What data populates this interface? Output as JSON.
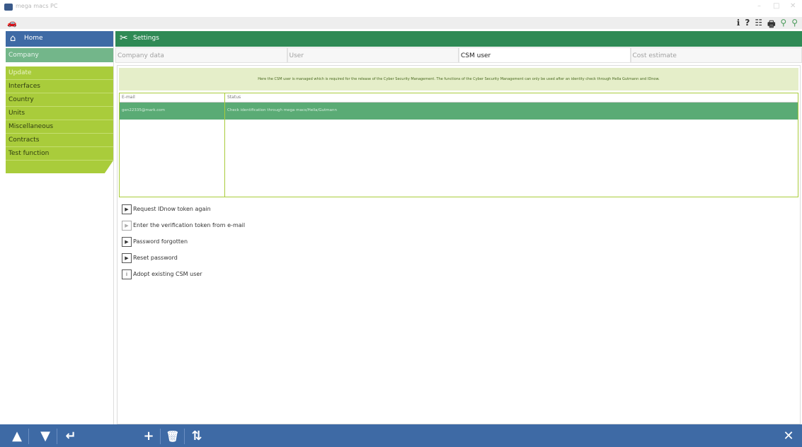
{
  "window": {
    "title": "mega macs PC",
    "controls": [
      "–",
      "□",
      "✕"
    ]
  },
  "toolbar": {
    "left_icon": "car-icon",
    "tools": [
      "ℹ",
      "?",
      "☷",
      "🖶",
      "⚲",
      "⚲"
    ]
  },
  "sidebar": {
    "home_label": "Home",
    "company_label": "Company",
    "items": [
      "Update",
      "Interfaces",
      "Country",
      "Units",
      "Miscellaneous",
      "Contracts",
      "Test function"
    ]
  },
  "header": {
    "title": "Settings"
  },
  "tabs": [
    "Company data",
    "User",
    "CSM user",
    "Cost estimate"
  ],
  "active_tab": "CSM user",
  "info_text": "Here the CSM user is managed which is required for the release of the Cyber Security Management. The functions of the Cyber Security Management can only be used after an identity check through Hella Gutmann and IDnow.",
  "table": {
    "columns": [
      "E-mail",
      "Status"
    ],
    "rows": [
      {
        "email": "gen22335@mark.com",
        "status": "Check identification through mega macs/Hella/Gutmann"
      }
    ]
  },
  "actions": [
    {
      "label": "Request IDnow token again",
      "icon": "play-icon",
      "enabled": true
    },
    {
      "label": "Enter the verification token from e-mail",
      "icon": "play-icon",
      "enabled": false
    },
    {
      "label": "Password forgotten",
      "icon": "play-icon",
      "enabled": true
    },
    {
      "label": "Reset password",
      "icon": "play-icon",
      "enabled": true
    },
    {
      "label": "Adopt existing CSM user",
      "icon": "info-icon",
      "enabled": true
    }
  ],
  "bottom_bar": {
    "up": "▲",
    "down": "▼",
    "enter": "↵",
    "add": "+",
    "delete": "🗑",
    "sync": "⇅",
    "close": "✕"
  },
  "colors": {
    "nav_blue": "#3e6aa5",
    "header_green": "#2f8a55",
    "menu_lime": "#a9cc3b",
    "selection_green": "#5aab75"
  }
}
